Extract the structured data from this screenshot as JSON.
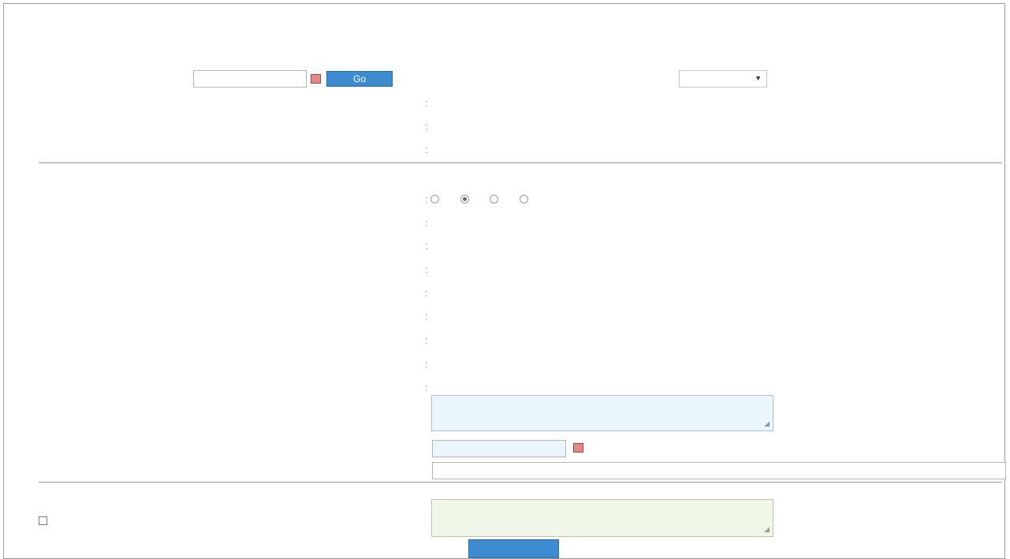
{
  "page": {
    "title": ""
  },
  "header_row": {
    "date_label": "",
    "date_value": "",
    "go_button": "Go",
    "serial_label": "",
    "serial_value": "",
    "select_arrow": "▼"
  },
  "case": {
    "case_no_label": "",
    "case_no_value": "",
    "title_label": "",
    "title_value": "",
    "status_label": "",
    "status_state": "",
    "status_details": ""
  },
  "appellate": {
    "section_title": "",
    "court_label": "",
    "court_options": [
      {
        "label": "",
        "selected": false
      },
      {
        "label": "",
        "selected": true
      },
      {
        "label": "",
        "selected": false
      },
      {
        "label": "",
        "selected": false
      }
    ],
    "case_no_label": "",
    "case_no_value": "",
    "case_parties_label": "",
    "case_parties_value": "",
    "case_reg_label": "",
    "case_reg_value": "",
    "disposal_date_label": "",
    "disposal_date_value": "",
    "outward_no_label": "",
    "outward_no_value": "",
    "order_date_label": "",
    "order_date_value": "",
    "writ_type_label": "",
    "writ_type_value": "",
    "compliance_due_label": "",
    "compliance_due_value": ""
  },
  "compliance": {
    "conclusions_label": "",
    "conclusions_value": "",
    "date_label": "",
    "date_value": "",
    "dispatch_label": "",
    "dispatch_value": ""
  },
  "remarks": {
    "section_title": "",
    "checkbox_label": "",
    "value": ""
  },
  "submit_label": ""
}
